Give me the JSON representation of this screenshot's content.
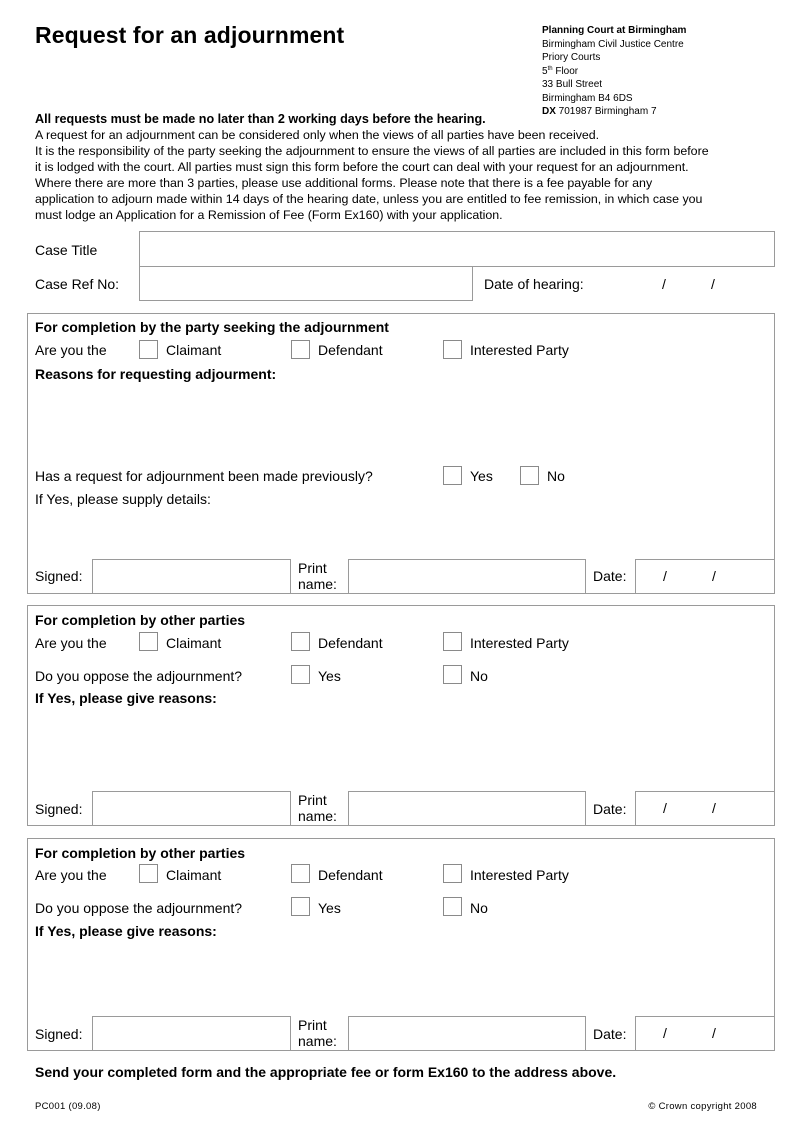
{
  "header": {
    "title": "Request for an adjournment",
    "address": {
      "court": "Planning Court at Birmingham",
      "line1": "Birmingham Civil Justice Centre",
      "line2": "Priory Courts",
      "floor_num": "5",
      "floor_sup": "th",
      "floor_word": " Floor",
      "line4": "33 Bull Street",
      "line5": "Birmingham B4 6DS",
      "dx_label": "DX",
      "dx_value": " 701987 Birmingham 7"
    }
  },
  "intro": {
    "warning": "All requests must be made no later than 2 working days before the hearing.",
    "line1": "A request for an adjournment can be considered only when the views of all parties have been received.",
    "line2": "It is the responsibility of the party seeking the adjournment to ensure the views of all parties are included in this form before",
    "line3": "it is lodged with the court. All parties must sign this form before the court can deal with your request for an adjournment.",
    "line4": "Where there are more than 3 parties, please use additional forms.  Please note that there is a fee payable for any",
    "line5": "application to adjourn made within 14 days of the hearing date, unless you are entitled to fee remission, in which case you",
    "line6": "must lodge an Application for a Remission of Fee (Form Ex160) with your application."
  },
  "case": {
    "title_label": "Case Title",
    "title_value": "",
    "ref_label": "Case Ref No:",
    "ref_value": "",
    "hearing_label": "Date of hearing:",
    "date_sep": "/"
  },
  "seeking": {
    "heading": "For completion by the party seeking the adjournment",
    "are_you": "Are you the",
    "claimant": "Claimant",
    "defendant": "Defendant",
    "interested": "Interested Party",
    "reasons_heading": "Reasons for requesting adjourment:",
    "previous_q": "Has a request for adjournment been made previously?",
    "yes": "Yes",
    "no": "No",
    "details": "If Yes, please supply details:",
    "signed": "Signed:",
    "print1": "Print",
    "print2": "name:",
    "date": "Date:",
    "date_sep": "/"
  },
  "other1": {
    "heading": "For completion by other parties",
    "are_you": "Are you the",
    "claimant": "Claimant",
    "defendant": "Defendant",
    "interested": "Interested Party",
    "oppose_q": "Do you oppose the adjournment?",
    "yes": "Yes",
    "no": "No",
    "reasons": "If Yes, please give reasons:",
    "signed": "Signed:",
    "print1": "Print",
    "print2": "name:",
    "date": "Date:",
    "date_sep": "/"
  },
  "other2": {
    "heading": "For completion by other parties",
    "are_you": "Are you the",
    "claimant": "Claimant",
    "defendant": "Defendant",
    "interested": "Interested Party",
    "oppose_q": "Do you oppose the adjournment?",
    "yes": "Yes",
    "no": "No",
    "reasons": "If Yes, please give reasons:",
    "signed": "Signed:",
    "print1": "Print",
    "print2": "name:",
    "date": "Date:",
    "date_sep": "/"
  },
  "footer": {
    "send": "Send your completed form and the appropriate fee  or form Ex160 to the address above.",
    "form_code": "PC001 (09.08)",
    "copyright": "© Crown copyright 2008"
  }
}
